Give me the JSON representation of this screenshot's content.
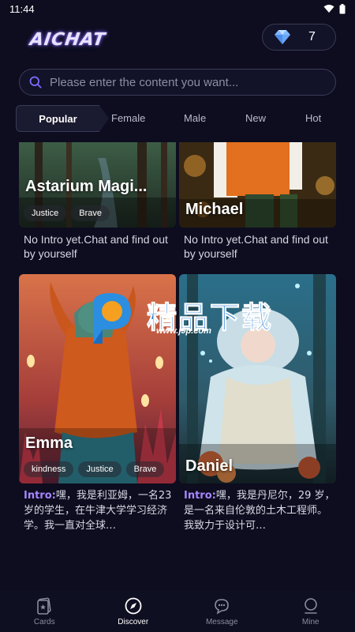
{
  "status_bar": {
    "time": "11:44"
  },
  "header": {
    "logo_text": "AICHAT",
    "gem_count": "7"
  },
  "search": {
    "placeholder": "Please enter the content you want..."
  },
  "tabs": {
    "active": "Popular",
    "items": [
      "Female",
      "Male",
      "New",
      "Hot"
    ]
  },
  "cards": [
    {
      "name": "Astarium Magi...",
      "tags": [
        "Justice",
        "Brave"
      ],
      "desc": "No Intro yet.Chat and find out by yourself"
    },
    {
      "name": "Michael",
      "tags": [],
      "desc": "No Intro yet.Chat and find out by yourself"
    },
    {
      "name": "Emma",
      "tags": [
        "kindness",
        "Justice",
        "Brave"
      ],
      "intro_label": "Intro:",
      "desc": "嘿，我是利亚姆，一名23 岁的学生，在牛津大学学习经济学。我一直对全球…"
    },
    {
      "name": "Daniel",
      "tags": [],
      "intro_label": "Intro:",
      "desc": "嘿，我是丹尼尔，29 岁，是一名来自伦敦的土木工程师。我致力于设计可…"
    }
  ],
  "watermark": {
    "text": "精品下载",
    "url": "www.j9p.com"
  },
  "bottom_nav": [
    {
      "label": "Cards",
      "icon": "cards-icon"
    },
    {
      "label": "Discover",
      "icon": "compass-icon",
      "active": true
    },
    {
      "label": "Message",
      "icon": "chat-bubble-icon"
    },
    {
      "label": "Mine",
      "icon": "profile-icon"
    }
  ],
  "colors": {
    "background": "#0d0d1f",
    "accent": "#a886ff",
    "intro": "#a886ff"
  }
}
